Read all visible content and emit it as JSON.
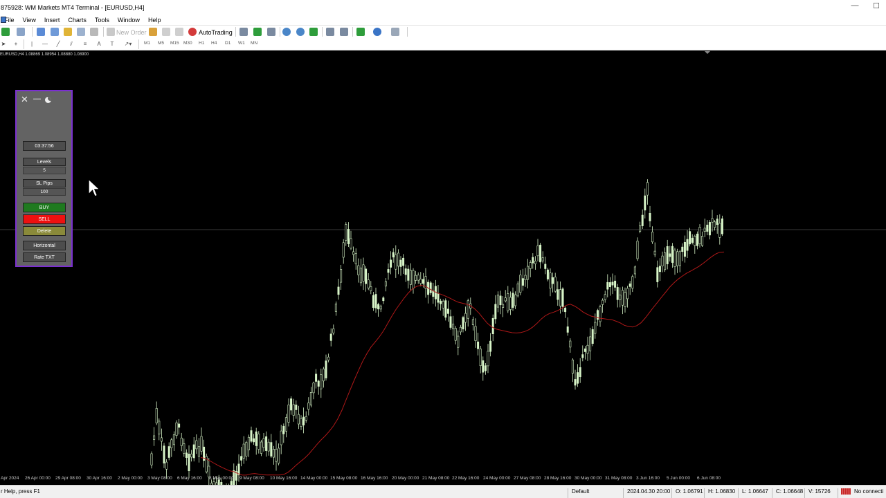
{
  "window": {
    "title": "875928: WM Markets MT4 Terminal - [EURUSD,H4]",
    "minimize_glyph": "—",
    "restore_glyph": "☐"
  },
  "menu": [
    "File",
    "View",
    "Insert",
    "Charts",
    "Tools",
    "Window",
    "Help"
  ],
  "toolbar": {
    "new_order": "New Order",
    "autotrading": "AutoTrading",
    "timeframes": [
      "M1",
      "M5",
      "M15",
      "M30",
      "H1",
      "H4",
      "D1",
      "W1",
      "MN"
    ]
  },
  "chart": {
    "info": "EURUSD,H4  1.08869 1.08954 1.08880 1.08900",
    "background": "#000000",
    "candle_color": "#d8f5c8",
    "ma_color": "#b01818"
  },
  "panel": {
    "timer": "03:37:56",
    "levels_label": "Levels",
    "levels_value": "5",
    "sl_label": "SL Pips",
    "sl_value": "100",
    "buy_label": "BUY",
    "sell_label": "SELL",
    "delete_label": "Delete",
    "horizontal_label": "Horizontal",
    "rate_label": "Rate TXT",
    "border_color": "#7b2fd0"
  },
  "xaxis": [
    "Apr 2024",
    "26 Apr 00:00",
    "29 Apr 08:00",
    "30 Apr 16:00",
    "2 May 00:00",
    "3 May 08:00",
    "6 May 16:00",
    "8 May 00:00",
    "9 May 08:00",
    "10 May 16:00",
    "14 May 00:00",
    "15 May 08:00",
    "16 May 16:00",
    "20 May 00:00",
    "21 May 08:00",
    "22 May 16:00",
    "24 May 00:00",
    "27 May 08:00",
    "28 May 16:00",
    "30 May 00:00",
    "31 May 08:00",
    "3 Jun 16:00",
    "5 Jun 00:00",
    "6 Jun 08:00"
  ],
  "status": {
    "help": "r Help, press F1",
    "profile": "Default",
    "datetime": "2024.04.30 20:00",
    "open": "O: 1.06791",
    "high": "H: 1.06830",
    "low": "L: 1.06647",
    "close": "C: 1.06648",
    "volume": "V: 15726",
    "connection": "No connecti"
  }
}
